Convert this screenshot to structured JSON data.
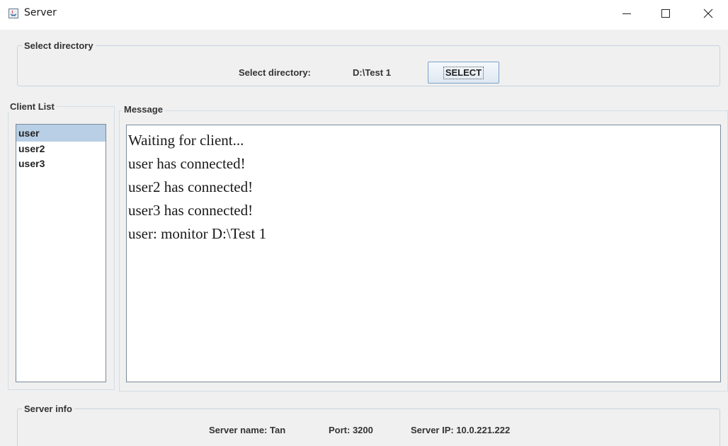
{
  "window": {
    "title": "Server",
    "controls": {
      "minimize": "minimize-icon",
      "maximize": "maximize-icon",
      "close": "close-icon"
    }
  },
  "select_directory": {
    "group_title": "Select directory",
    "label": "Select directory:",
    "value": "D:\\Test 1",
    "button_label": "SELECT"
  },
  "client_list": {
    "title": "Client List",
    "items": [
      {
        "label": "user",
        "selected": true
      },
      {
        "label": "user2",
        "selected": false
      },
      {
        "label": "user3",
        "selected": false
      }
    ]
  },
  "message": {
    "title": "Message",
    "lines": [
      "Waiting for client...",
      "user has connected!",
      "user2 has connected!",
      "user3 has connected!",
      "user: monitor D:\\Test 1"
    ]
  },
  "server_info": {
    "title": "Server info",
    "server_name": "Server name: Tan",
    "port": "Port: 3200",
    "server_ip": "Server IP: 10.0.221.222"
  },
  "colors": {
    "window_bg": "#f0f0f0",
    "selection": "#b8cfe5",
    "group_border": "#c6d4e0",
    "button_border": "#7aa2c8"
  }
}
